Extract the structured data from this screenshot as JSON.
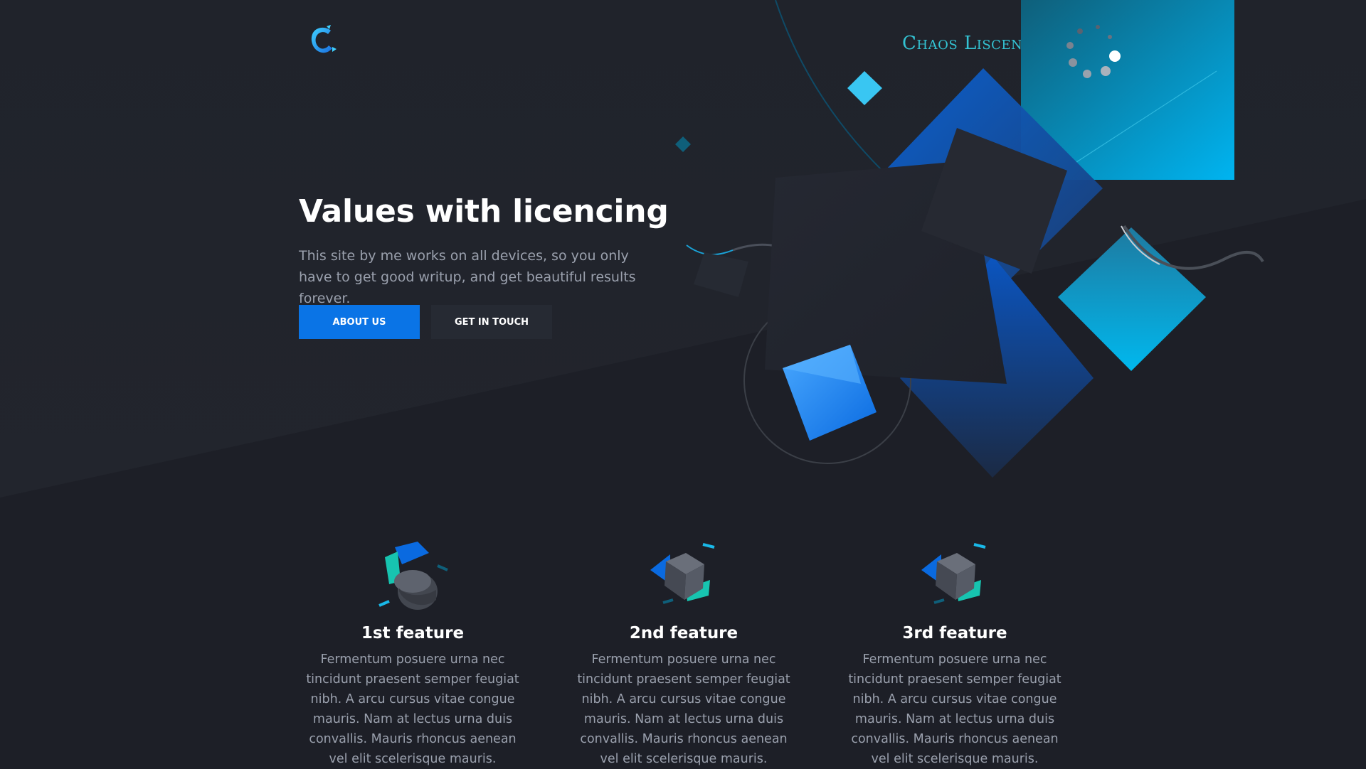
{
  "header": {
    "logo_icon": "c-letter-logo-icon",
    "brand_name": "Chaos Liscencing",
    "brand_color": "#33c3d3"
  },
  "hero": {
    "title": "Values with licencing",
    "subtitle": "This site by me works on all devices, so you only have to get good writup, and get beautiful results forever.",
    "primary_button": "ABOUT US",
    "secondary_button": "GET IN TOUCH",
    "accent_color": "#0a74e6"
  },
  "features": [
    {
      "icon": "cylinder-shapes-icon",
      "title": "1st feature",
      "text": "Fermentum posuere urna nec tincidunt praesent semper feugiat nibh. A arcu cursus vitae congue mauris. Nam at lectus urna duis convallis. Mauris rhoncus aenean vel elit scelerisque mauris."
    },
    {
      "icon": "cube-shapes-icon",
      "title": "2nd feature",
      "text": "Fermentum posuere urna nec tincidunt praesent semper feugiat nibh. A arcu cursus vitae congue mauris. Nam at lectus urna duis convallis. Mauris rhoncus aenean vel elit scelerisque mauris."
    },
    {
      "icon": "cube-shapes-icon",
      "title": "3rd feature",
      "text": "Fermentum posuere urna nec tincidunt praesent semper feugiat nibh. A arcu cursus vitae congue mauris. Nam at lectus urna duis convallis. Mauris rhoncus aenean vel elit scelerisque mauris."
    }
  ]
}
